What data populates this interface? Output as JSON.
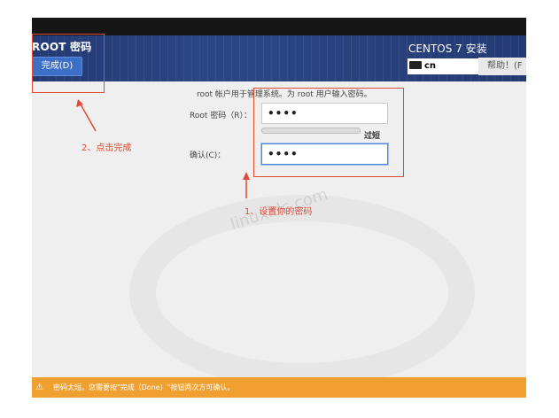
{
  "header": {
    "title": "ROOT 密码",
    "done_label": "完成(D)",
    "installer_title": "CENTOS 7 安装",
    "keyboard_layout": "cn",
    "help_label": "帮助！(F"
  },
  "form": {
    "instruction": "root 帐户用于管理系统。为 root 用户输入密码。",
    "root_password_label": "Root 密码（R）：",
    "root_password_value": "••••",
    "strength_label": "过短",
    "confirm_label": "确认(C)：",
    "confirm_value": "••••"
  },
  "annotations": {
    "step1": "1、设置你的密码",
    "step2": "2、点击完成",
    "color": "#e04b36"
  },
  "watermark": "linuxidc.com",
  "status_bar": {
    "warning_text": "密码太短。您需要按\"完成（Done）\"按钮两次方可确认。",
    "color": "#f0a030"
  }
}
